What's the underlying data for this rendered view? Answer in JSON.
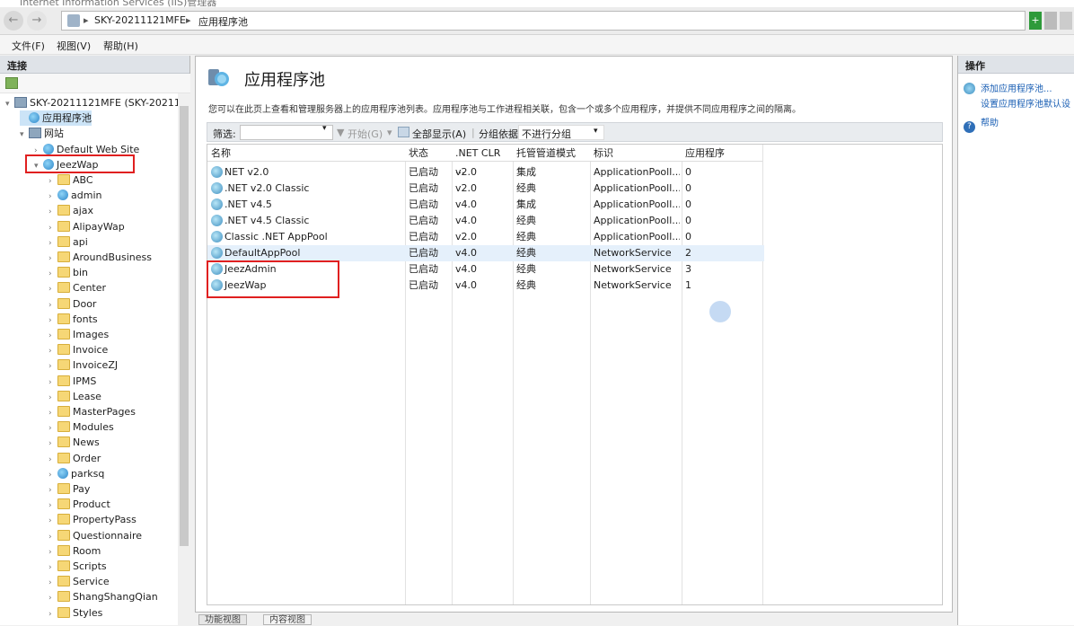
{
  "window": {
    "title": "Internet Information Services (IIS)管理器"
  },
  "address": {
    "server": "SKY-20211121MFE",
    "node": "应用程序池"
  },
  "menu": [
    "文件(F)",
    "视图(V)",
    "帮助(H)"
  ],
  "connections": {
    "header": "连接",
    "tree": [
      {
        "label": "SKY-20211121MFE (SKY-2021111",
        "level": 0,
        "icon": "server-icon",
        "exp": "▾"
      },
      {
        "label": "应用程序池",
        "level": 1,
        "icon": "app-pool-icon",
        "exp": "",
        "selected": true
      },
      {
        "label": "网站",
        "level": 1,
        "icon": "sites-icon",
        "exp": "▾"
      },
      {
        "label": "Default Web Site",
        "level": 2,
        "icon": "globe-icon",
        "exp": "›"
      },
      {
        "label": "JeezWap",
        "level": 2,
        "icon": "globe-icon",
        "exp": "▾"
      },
      {
        "label": "ABC",
        "level": 3,
        "icon": "folder-icon",
        "exp": "›"
      },
      {
        "label": "admin",
        "level": 3,
        "icon": "app-icon",
        "exp": "›"
      },
      {
        "label": "ajax",
        "level": 3,
        "icon": "folder-icon",
        "exp": "›"
      },
      {
        "label": "AlipayWap",
        "level": 3,
        "icon": "folder-icon",
        "exp": "›"
      },
      {
        "label": "api",
        "level": 3,
        "icon": "folder-icon",
        "exp": "›"
      },
      {
        "label": "AroundBusiness",
        "level": 3,
        "icon": "folder-icon",
        "exp": "›"
      },
      {
        "label": "bin",
        "level": 3,
        "icon": "folder-icon",
        "exp": "›"
      },
      {
        "label": "Center",
        "level": 3,
        "icon": "folder-icon",
        "exp": "›"
      },
      {
        "label": "Door",
        "level": 3,
        "icon": "folder-icon",
        "exp": "›"
      },
      {
        "label": "fonts",
        "level": 3,
        "icon": "folder-icon",
        "exp": "›"
      },
      {
        "label": "Images",
        "level": 3,
        "icon": "folder-icon",
        "exp": "›"
      },
      {
        "label": "Invoice",
        "level": 3,
        "icon": "folder-icon",
        "exp": "›"
      },
      {
        "label": "InvoiceZJ",
        "level": 3,
        "icon": "folder-icon",
        "exp": "›"
      },
      {
        "label": "IPMS",
        "level": 3,
        "icon": "folder-icon",
        "exp": "›"
      },
      {
        "label": "Lease",
        "level": 3,
        "icon": "folder-icon",
        "exp": "›"
      },
      {
        "label": "MasterPages",
        "level": 3,
        "icon": "folder-icon",
        "exp": "›"
      },
      {
        "label": "Modules",
        "level": 3,
        "icon": "folder-icon",
        "exp": "›"
      },
      {
        "label": "News",
        "level": 3,
        "icon": "folder-icon",
        "exp": "›"
      },
      {
        "label": "Order",
        "level": 3,
        "icon": "folder-icon",
        "exp": "›"
      },
      {
        "label": "parksq",
        "level": 3,
        "icon": "app-icon",
        "exp": "›"
      },
      {
        "label": "Pay",
        "level": 3,
        "icon": "folder-icon",
        "exp": "›"
      },
      {
        "label": "Product",
        "level": 3,
        "icon": "folder-icon",
        "exp": "›"
      },
      {
        "label": "PropertyPass",
        "level": 3,
        "icon": "folder-icon",
        "exp": "›"
      },
      {
        "label": "Questionnaire",
        "level": 3,
        "icon": "folder-icon",
        "exp": "›"
      },
      {
        "label": "Room",
        "level": 3,
        "icon": "folder-icon",
        "exp": "›"
      },
      {
        "label": "Scripts",
        "level": 3,
        "icon": "folder-icon",
        "exp": "›"
      },
      {
        "label": "Service",
        "level": 3,
        "icon": "folder-icon",
        "exp": "›"
      },
      {
        "label": "ShangShangQian",
        "level": 3,
        "icon": "folder-icon",
        "exp": "›"
      },
      {
        "label": "Styles",
        "level": 3,
        "icon": "folder-icon",
        "exp": "›"
      }
    ]
  },
  "main": {
    "title": "应用程序池",
    "description": "您可以在此页上查看和管理服务器上的应用程序池列表。应用程序池与工作进程相关联，包含一个或多个应用程序，并提供不同应用程序之间的隔离。",
    "filter": {
      "label": "筛选:",
      "start": "开始(G)",
      "show_all": "全部显示(A)",
      "group_label": "分组依据:",
      "group_value": "不进行分组"
    },
    "columns": [
      "名称",
      "状态",
      ".NET CLR ...",
      "托管管道模式",
      "标识",
      "应用程序"
    ],
    "rows": [
      [
        "NET v2.0",
        "已启动",
        "v2.0",
        "集成",
        "ApplicationPooll...",
        "0"
      ],
      [
        ".NET v2.0 Classic",
        "已启动",
        "v2.0",
        "经典",
        "ApplicationPooll...",
        "0"
      ],
      [
        ".NET v4.5",
        "已启动",
        "v4.0",
        "集成",
        "ApplicationPooll...",
        "0"
      ],
      [
        ".NET v4.5 Classic",
        "已启动",
        "v4.0",
        "经典",
        "ApplicationPooll...",
        "0"
      ],
      [
        "Classic .NET AppPool",
        "已启动",
        "v2.0",
        "经典",
        "ApplicationPooll...",
        "0"
      ],
      [
        "DefaultAppPool",
        "已启动",
        "v4.0",
        "经典",
        "NetworkService",
        "2"
      ],
      [
        "JeezAdmin",
        "已启动",
        "v4.0",
        "经典",
        "NetworkService",
        "3"
      ],
      [
        "JeezWap",
        "已启动",
        "v4.0",
        "经典",
        "NetworkService",
        "1"
      ]
    ],
    "selected_row": 5,
    "tabs": [
      "功能视图",
      "内容视图"
    ]
  },
  "actions": {
    "header": "操作",
    "items": [
      "添加应用程序池...",
      "设置应用程序池默认设",
      "帮助"
    ]
  },
  "colors": {
    "accent": "#1a5fb4",
    "highlight_box": "#e02020",
    "selected_row": "#e5f0fb"
  }
}
